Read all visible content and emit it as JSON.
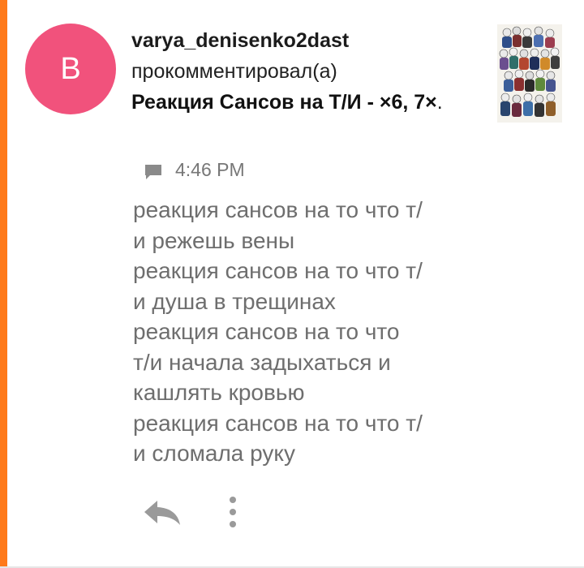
{
  "notification": {
    "avatar_letter": "B",
    "avatar_color": "#f1527c",
    "username": "varya_denisenko2dast",
    "action": "прокомментировал(а)",
    "story_title": "Реакция Сансов на Т/И - ×6, 7×",
    "story_title_end": ".",
    "time": "4:46 PM",
    "comment_lines": [
      "реакция сансов на то что т/",
      "и режешь вены",
      "реакция сансов на то что т/",
      "и душа в трещинах",
      "реакция сансов на то что",
      "т/и начала задыхаться и",
      "кашлять кровью",
      "реакция сансов на то что т/",
      "и сломала руку"
    ]
  },
  "icons": {
    "comment": "comment-icon",
    "reply": "reply-icon",
    "more": "more-vertical-icon"
  },
  "colors": {
    "accent": "#ff7a1a",
    "comment_text": "#6e6e6e",
    "meta_text": "#777777"
  }
}
